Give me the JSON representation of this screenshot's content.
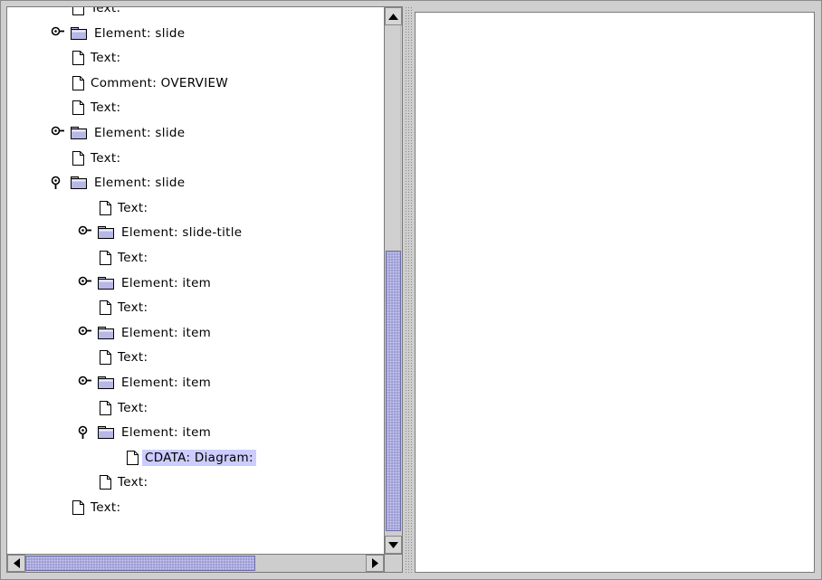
{
  "tree": {
    "rows": [
      {
        "label": "Text:",
        "kind": "doc",
        "level": 0
      },
      {
        "label": "Element: slide",
        "kind": "element",
        "level": 0,
        "expanded": false
      },
      {
        "label": "Text:",
        "kind": "doc",
        "level": 0
      },
      {
        "label": "Comment: OVERVIEW",
        "kind": "doc",
        "level": 0
      },
      {
        "label": "Text:",
        "kind": "doc",
        "level": 0
      },
      {
        "label": "Element: slide",
        "kind": "element",
        "level": 0,
        "expanded": false
      },
      {
        "label": "Text:",
        "kind": "doc",
        "level": 0
      },
      {
        "label": "Element: slide",
        "kind": "element",
        "level": 0,
        "expanded": true
      },
      {
        "label": "Text:",
        "kind": "doc",
        "level": 1
      },
      {
        "label": "Element: slide-title",
        "kind": "element",
        "level": 1,
        "expanded": false
      },
      {
        "label": "Text:",
        "kind": "doc",
        "level": 1
      },
      {
        "label": "Element: item",
        "kind": "element",
        "level": 1,
        "expanded": false
      },
      {
        "label": "Text:",
        "kind": "doc",
        "level": 1
      },
      {
        "label": "Element: item",
        "kind": "element",
        "level": 1,
        "expanded": false
      },
      {
        "label": "Text:",
        "kind": "doc",
        "level": 1
      },
      {
        "label": "Element: item",
        "kind": "element",
        "level": 1,
        "expanded": false
      },
      {
        "label": "Text:",
        "kind": "doc",
        "level": 1
      },
      {
        "label": "Element: item",
        "kind": "element",
        "level": 1,
        "expanded": true
      },
      {
        "label": "CDATA: Diagram:",
        "kind": "doc",
        "level": 2,
        "selected": true
      },
      {
        "label": "Text:",
        "kind": "doc",
        "level": 1
      },
      {
        "label": "Text:",
        "kind": "doc",
        "level": 0
      }
    ],
    "selection_color": "#ccccff"
  },
  "icons": {
    "leaf": "document-icon",
    "element": "folder-icon",
    "collapsed_handle": "collapsed-handle-icon",
    "expanded_handle": "expanded-handle-icon",
    "scroll_up": "arrow-up-icon",
    "scroll_down": "arrow-down-icon",
    "scroll_left": "arrow-left-icon",
    "scroll_right": "arrow-right-icon"
  },
  "scrollbars": {
    "vertical_position": 0.44,
    "horizontal_position": 0.0
  },
  "colors": {
    "background": "#cfcfcf",
    "scroll_thumb": "#9d9dd4",
    "panel": "#ffffff"
  }
}
